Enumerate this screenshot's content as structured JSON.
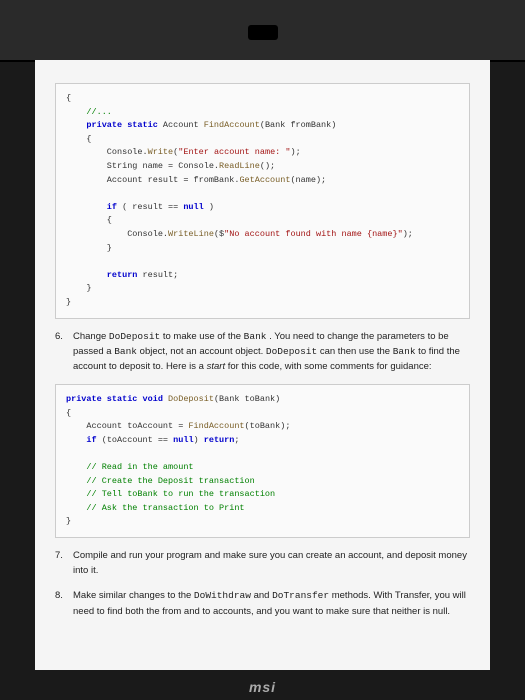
{
  "code1": {
    "l1": "{",
    "l2": "    //...",
    "l3_a": "    private static ",
    "l3_b": "Account ",
    "l3_c": "FindAccount",
    "l3_d": "(Bank fromBank)",
    "l4": "    {",
    "l5_a": "        Console.",
    "l5_b": "Write",
    "l5_c": "(",
    "l5_d": "\"Enter account name: \"",
    "l5_e": ");",
    "l6_a": "        String name = Console.",
    "l6_b": "ReadLine",
    "l6_c": "();",
    "l7_a": "        Account result = fromBank.",
    "l7_b": "GetAccount",
    "l7_c": "(name);",
    "l8": "",
    "l9_a": "        if ",
    "l9_b": "( result == ",
    "l9_c": "null ",
    "l9_d": ")",
    "l10": "        {",
    "l11_a": "            Console.",
    "l11_b": "WriteLine",
    "l11_c": "($",
    "l11_d": "\"No account found with name {name}\"",
    "l11_e": ");",
    "l12": "        }",
    "l13": "",
    "l14_a": "        return ",
    "l14_b": "result;",
    "l15": "    }",
    "l16": "}"
  },
  "instruction6": {
    "num": "6.",
    "p1": "Change ",
    "p2": "DoDeposit",
    "p3": " to make use of the ",
    "p4": "Bank",
    "p5": " . You need to change the parameters to be passed a ",
    "p6": "Bank",
    "p7": " object, not an account object. ",
    "p8": "DoDeposit",
    "p9": " can then use the ",
    "p10": "Bank",
    "p11": " to find the account to deposit to. Here is a ",
    "p12": "start",
    "p13": " for this code, with some comments for guidance:"
  },
  "code2": {
    "l1_a": "private static void ",
    "l1_b": "DoDeposit",
    "l1_c": "(Bank toBank)",
    "l2": "{",
    "l3_a": "    Account toAccount = ",
    "l3_b": "FindAccount",
    "l3_c": "(toBank);",
    "l4_a": "    if ",
    "l4_b": "(toAccount == ",
    "l4_c": "null",
    "l4_d": ") ",
    "l4_e": "return",
    "l4_f": ";",
    "l5": "",
    "l6": "    // Read in the amount",
    "l7": "    // Create the Deposit transaction",
    "l8": "    // Tell toBank to run the transaction",
    "l9": "    // Ask the transaction to Print",
    "l10": "}"
  },
  "instruction7": {
    "num": "7.",
    "text": "Compile and run your program and make sure you can create an account, and deposit money into it."
  },
  "instruction8": {
    "num": "8.",
    "p1": "Make similar changes to the ",
    "p2": "DoWithdraw",
    "p3": " and ",
    "p4": "DoTransfer",
    "p5": " methods. With Transfer, you will need to find both the from and to accounts, and you want to make sure that neither is null."
  },
  "logo": "msi"
}
